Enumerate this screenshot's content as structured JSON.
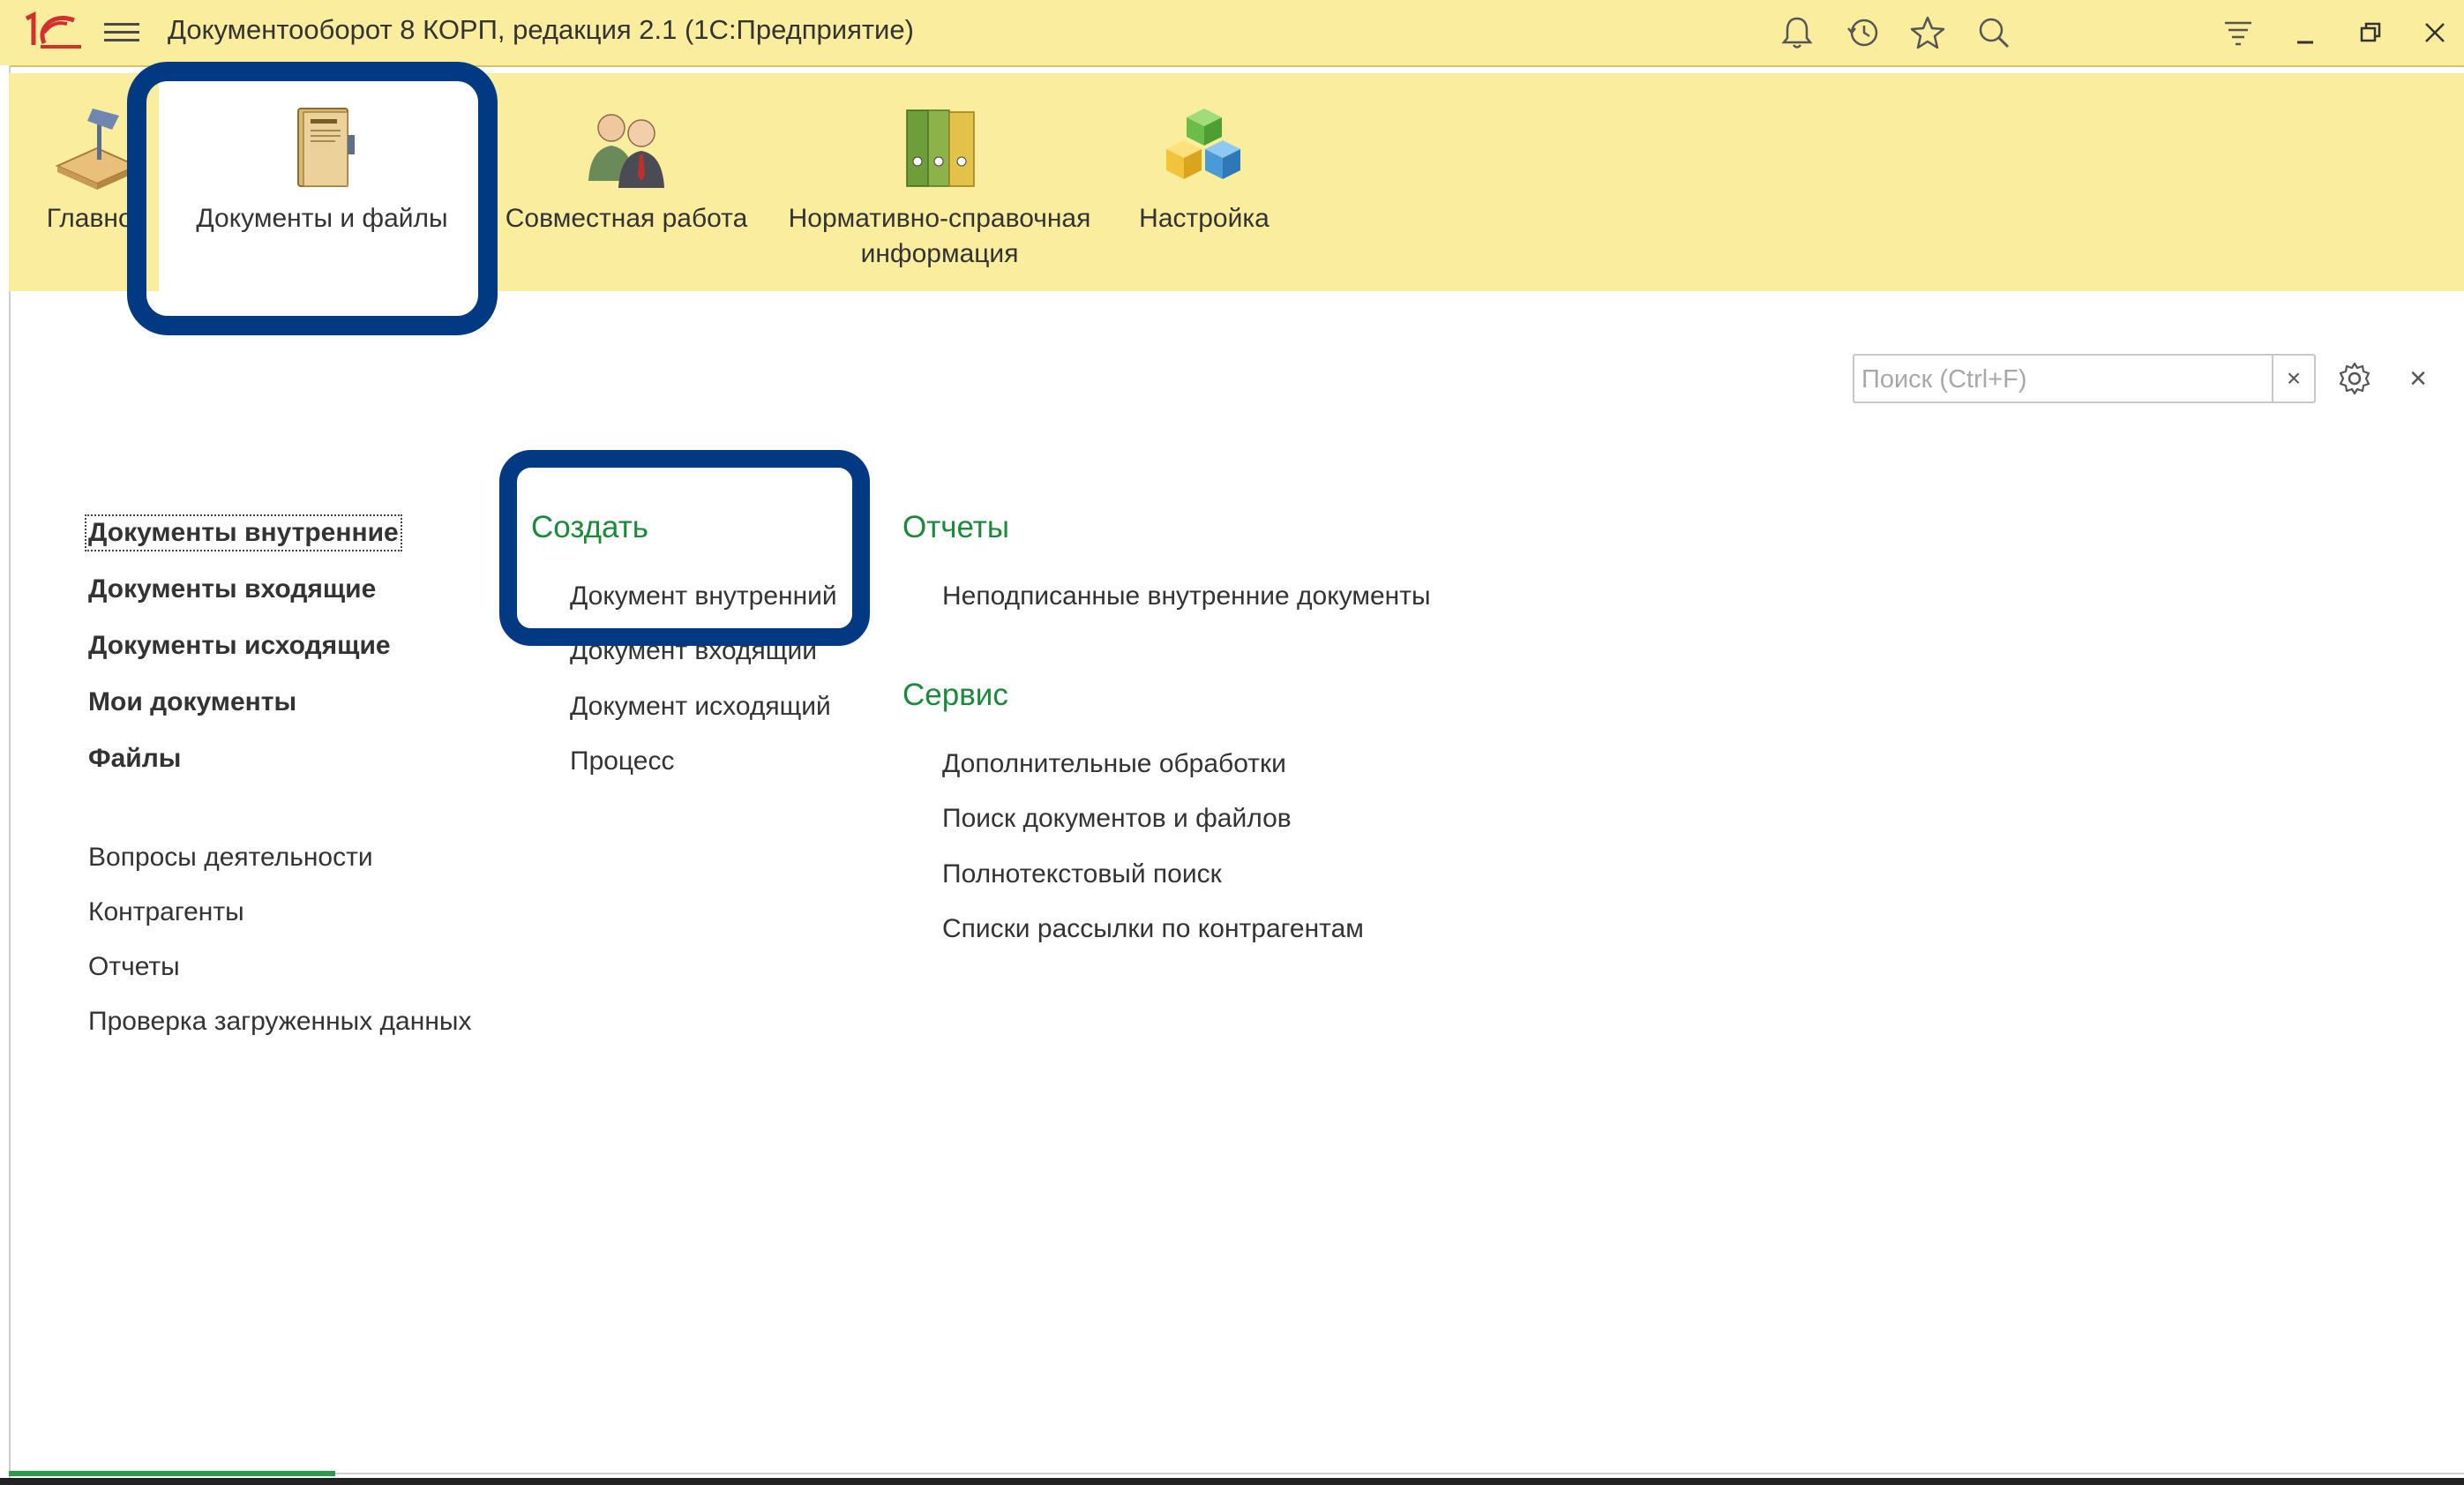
{
  "window": {
    "title": "Документооборот 8 КОРП, редакция 2.1  (1С:Предприятие)",
    "logo_text": "1С"
  },
  "titlebar_icons": [
    "bell-icon",
    "history-icon",
    "star-icon",
    "search-icon",
    "settings-lines-icon",
    "minimize-icon",
    "restore-icon",
    "close-icon"
  ],
  "sections": [
    {
      "label": "Главное",
      "icon": "desk-lamp-icon"
    },
    {
      "label": "Документы и файлы",
      "icon": "document-folder-icon",
      "active": true
    },
    {
      "label": "Совместная работа",
      "icon": "people-icon"
    },
    {
      "label": "Нормативно-справочная информация",
      "icon": "binders-icon"
    },
    {
      "label": "Настройка",
      "icon": "cubes-icon"
    }
  ],
  "search": {
    "placeholder": "Поиск (Ctrl+F)",
    "clear_label": "×"
  },
  "panel_close": "×",
  "nav": {
    "primary": [
      "Документы внутренние",
      "Документы входящие",
      "Документы исходящие",
      "Мои документы",
      "Файлы"
    ],
    "secondary": [
      "Вопросы деятельности",
      "Контрагенты",
      "Отчеты",
      "Проверка загруженных данных"
    ]
  },
  "create": {
    "title": "Создать",
    "items": [
      "Документ внутренний",
      "Документ входящий",
      "Документ исходящий",
      "Процесс"
    ]
  },
  "reports": {
    "title": "Отчеты",
    "items": [
      "Неподписанные внутренние документы"
    ]
  },
  "service": {
    "title": "Сервис",
    "items": [
      "Дополнительные обработки",
      "Поиск документов и файлов",
      "Полнотекстовый поиск",
      "Списки рассылки по контрагентам"
    ]
  },
  "colors": {
    "panel_bg": "#fbed9e",
    "highlight": "#013a82",
    "group_title": "#1a8a3a"
  }
}
